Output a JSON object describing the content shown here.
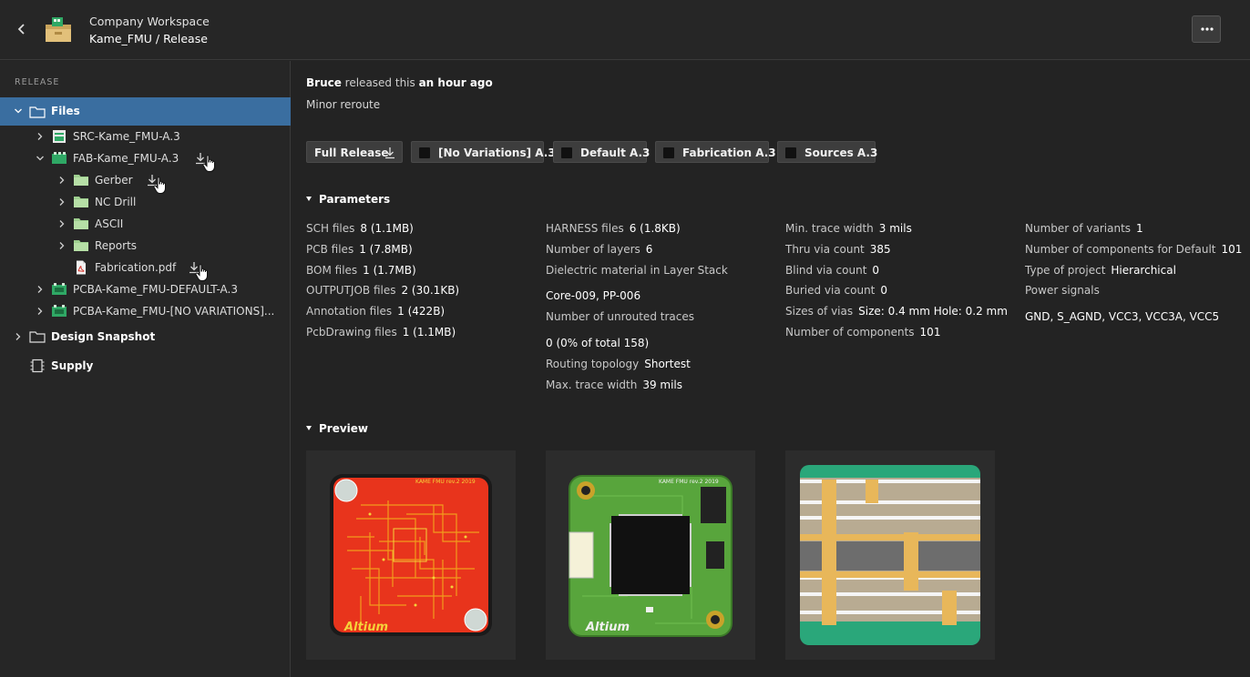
{
  "header": {
    "workspace": "Company Workspace",
    "project": "Kame_FMU",
    "separator": " / ",
    "page": "Release"
  },
  "sidebar": {
    "section_label": "RELEASE",
    "items": [
      {
        "label": "Files"
      },
      {
        "label": "SRC-Kame_FMU-A.3"
      },
      {
        "label": "FAB-Kame_FMU-A.3"
      },
      {
        "label": "Gerber"
      },
      {
        "label": "NC Drill"
      },
      {
        "label": "ASCII"
      },
      {
        "label": "Reports"
      },
      {
        "label": "Fabrication.pdf"
      },
      {
        "label": "PCBA-Kame_FMU-DEFAULT-A.3"
      },
      {
        "label": "PCBA-Kame_FMU-[NO VARIATIONS]..."
      },
      {
        "label": "Design Snapshot"
      },
      {
        "label": "Supply"
      }
    ]
  },
  "release": {
    "author": "Bruce",
    "action": " released this ",
    "when": "an hour ago",
    "description": "Minor reroute"
  },
  "buttons": [
    {
      "label": "Full Release"
    },
    {
      "label": "[No Variations] A.3"
    },
    {
      "label": "Default A.3"
    },
    {
      "label": "Fabrication A.3"
    },
    {
      "label": "Sources A.3"
    }
  ],
  "parameters": {
    "title": "Parameters",
    "col1": [
      {
        "k": "SCH files",
        "v": "8 (1.1MB)"
      },
      {
        "k": "PCB files",
        "v": "1 (7.8MB)"
      },
      {
        "k": "BOM files",
        "v": "1 (1.7MB)"
      },
      {
        "k": "OUTPUTJOB files",
        "v": "2 (30.1KB)"
      },
      {
        "k": "Annotation files",
        "v": "1 (422B)"
      },
      {
        "k": "PcbDrawing files",
        "v": "1 (1.1MB)"
      }
    ],
    "col2": [
      {
        "k": "HARNESS files",
        "v": "6 (1.8KB)"
      },
      {
        "k": "Number of layers",
        "v": "6"
      },
      {
        "k": "Dielectric material in Layer Stack",
        "v": ""
      },
      {
        "k": "",
        "v": "Core-009, PP-006"
      },
      {
        "k": "Number of unrouted traces",
        "v": ""
      },
      {
        "k": "",
        "v": "0 (0% of total 158)"
      },
      {
        "k": "Routing topology",
        "v": "Shortest"
      },
      {
        "k": "Max. trace width",
        "v": "39 mils"
      }
    ],
    "col3": [
      {
        "k": "Min. trace width",
        "v": "3 mils"
      },
      {
        "k": "Thru via count",
        "v": "385"
      },
      {
        "k": "Blind via count",
        "v": "0"
      },
      {
        "k": "Buried via count",
        "v": "0"
      },
      {
        "k": "Sizes of vias",
        "v": "Size: 0.4 mm Hole: 0.2 mm"
      },
      {
        "k": "Number of components",
        "v": "101"
      }
    ],
    "col4": [
      {
        "k": "Number of variants",
        "v": "1"
      },
      {
        "k": "Number of components for Default",
        "v": "101"
      },
      {
        "k": "Type of project",
        "v": "Hierarchical"
      },
      {
        "k": "Power signals",
        "v": ""
      },
      {
        "k": "",
        "v": "GND, S_AGND, VCC3, VCC3A, VCC5"
      }
    ]
  },
  "preview": {
    "title": "Preview",
    "cards": [
      {
        "kind": "pcb-2d",
        "board_text": "KAME FMU rev.2 2019",
        "logo": "Altium"
      },
      {
        "kind": "pcb-3d",
        "board_text": "KAME FMU rev.2 2019",
        "logo": "Altium"
      },
      {
        "kind": "layer-stack"
      }
    ]
  },
  "colors": {
    "selected": "#3a6ea0",
    "board_red": "#e8341c",
    "board_green": "#58a53c",
    "stack_green": "#2aa77a"
  }
}
